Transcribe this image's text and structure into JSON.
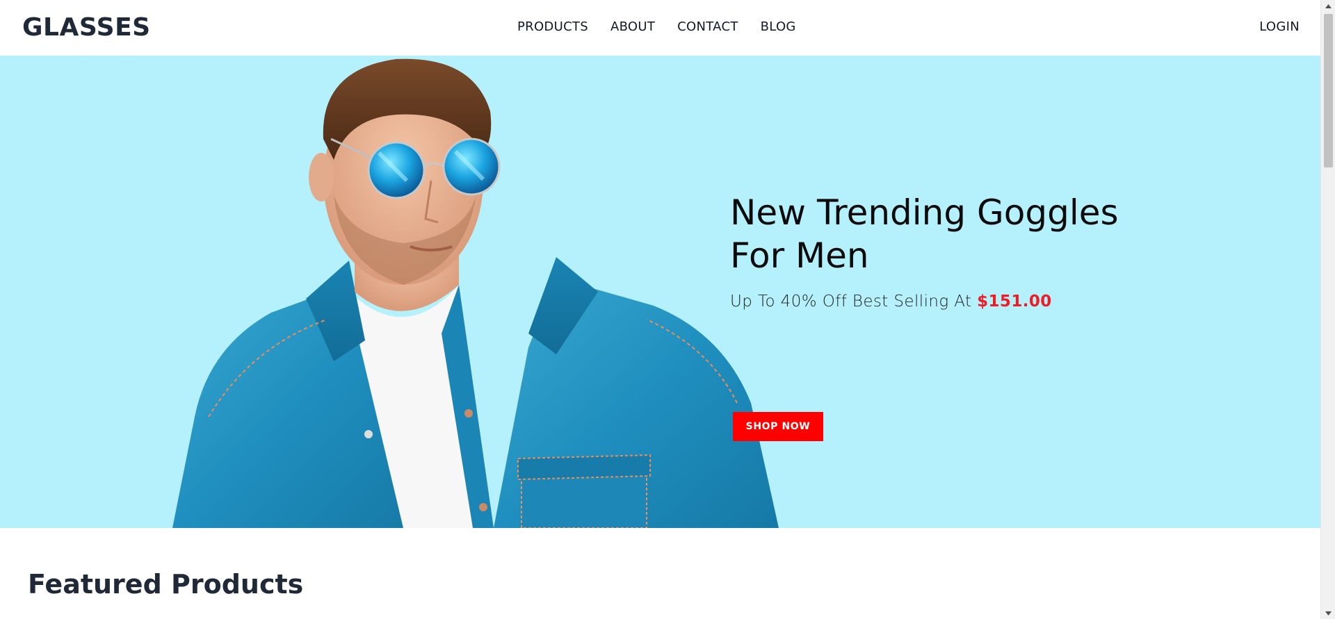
{
  "brand": {
    "logo": "GLASSES"
  },
  "nav": {
    "items": [
      {
        "label": "PRODUCTS"
      },
      {
        "label": "ABOUT"
      },
      {
        "label": "CONTACT"
      },
      {
        "label": "BLOG"
      }
    ],
    "login": "LOGIN"
  },
  "hero": {
    "title_line1": "New Trending Goggles",
    "title_line2": "For Men",
    "subtitle": "Up To 40% Off Best Selling At",
    "price": "$151.00",
    "cta": "SHOP NOW",
    "image_icon": "man-with-sunglasses-photo"
  },
  "featured": {
    "title": "Featured Products"
  },
  "colors": {
    "hero_bg": "#b5f1fc",
    "accent_red": "#ff0000",
    "price_red": "#ee1c25",
    "text_dark": "#1f2937"
  },
  "scrollbar": {
    "thumb_fraction": 0.26
  }
}
